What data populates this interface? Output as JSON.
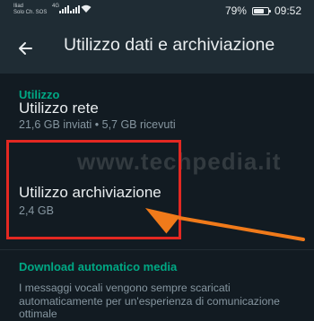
{
  "status_bar": {
    "carrier_line1": "Iliad",
    "carrier_line2": "Solo Ch. SOS",
    "network": "4G",
    "battery": "79%",
    "battery_level": 0.79,
    "time": "09:52"
  },
  "app_bar": {
    "back_icon": "arrow-left-icon",
    "title": "Utilizzo dati e archiviazione"
  },
  "sections": {
    "usage_header": "Utilizzo",
    "network_usage": {
      "title": "Utilizzo rete",
      "subtitle": "21,6 GB inviati • 5,7 GB ricevuti"
    },
    "storage_usage": {
      "title": "Utilizzo archiviazione",
      "subtitle": "2,4 GB"
    },
    "auto_download_header": "Download automatico media",
    "auto_download_desc": "I messaggi vocali vengono sempre scaricati automaticamente per un'esperienza di comunicazione ottimale"
  },
  "watermark": "www.techpedia.it",
  "colors": {
    "background": "#121b22",
    "bar": "#1f2c34",
    "accent": "#00a884",
    "highlight": "#e32822",
    "arrow": "#f07a1a"
  }
}
